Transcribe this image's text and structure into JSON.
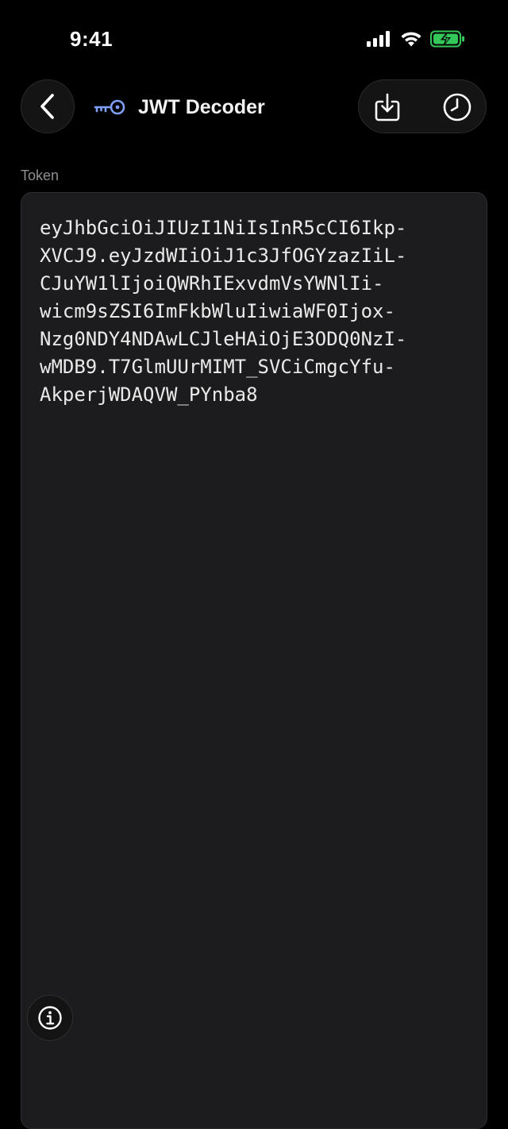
{
  "status_bar": {
    "time": "9:41",
    "battery_color": "#34c759"
  },
  "nav": {
    "title": "JWT Decoder",
    "back_icon": "chevron-left-icon",
    "title_icon": "key-icon",
    "actions": [
      "download-icon",
      "history-icon"
    ],
    "key_icon_color": "#7f9ef5"
  },
  "token": {
    "label": "Token",
    "lines": [
      "eyJhbGciOiJIUzI1NiIsInR5cCI6Ikp-",
      "XVCJ9.eyJzdWIiOiJ1c3JfOGYzazIiL-",
      "CJuYW1lIjoiQWRhIExvdmVsYWNlIi-",
      "wicm9sZSI6ImFkbWluIiwiaWF0Ijox-",
      "Nzg0NDY4NDAwLCJleHAiOjE3ODQ0NzI-",
      "wMDB9.T7GlmUUrMIMT_SVCiCmgcYfu-",
      "AkperjWDAQVW_PYnba8"
    ]
  },
  "info_icon": "info-icon"
}
